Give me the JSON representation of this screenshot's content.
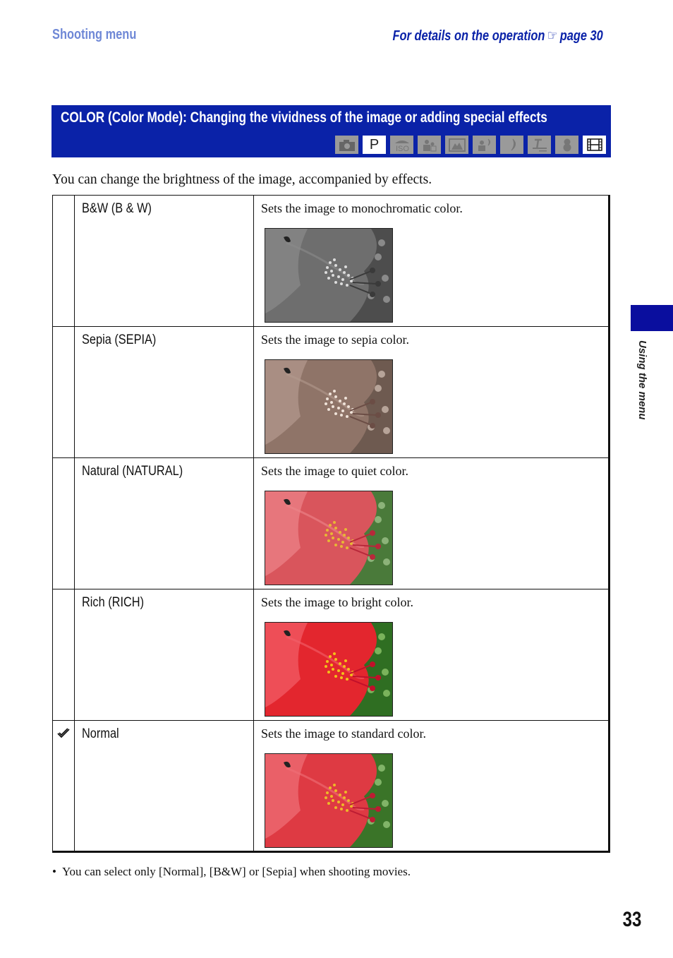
{
  "header": {
    "section": "Shooting menu",
    "details_prefix": "For details on the operation",
    "details_icon": "pointing-hand-icon",
    "details_icon_glyph": "☞",
    "details_page": "page 30"
  },
  "banner": {
    "title": "COLOR (Color Mode): Changing the vividness of the image or adding special effects",
    "modes": [
      {
        "name": "auto-camera-icon",
        "label": "",
        "enabled": false
      },
      {
        "name": "program-icon",
        "label": "P",
        "enabled": true
      },
      {
        "name": "high-sensitivity-iso-icon",
        "label": "",
        "enabled": false
      },
      {
        "name": "soft-snap-portrait-icon",
        "label": "",
        "enabled": false
      },
      {
        "name": "landscape-icon",
        "label": "",
        "enabled": false
      },
      {
        "name": "twilight-portrait-icon",
        "label": "",
        "enabled": false
      },
      {
        "name": "twilight-moon-icon",
        "label": "",
        "enabled": false
      },
      {
        "name": "beach-icon",
        "label": "",
        "enabled": false
      },
      {
        "name": "snow-icon",
        "label": "",
        "enabled": false
      },
      {
        "name": "movie-film-icon",
        "label": "",
        "enabled": true
      }
    ]
  },
  "intro": "You can change the brightness of the image, accompanied by effects.",
  "options": [
    {
      "name": "B&W (B & W)",
      "description": "Sets the image to monochromatic color.",
      "photo": "bw",
      "default": false
    },
    {
      "name": "Sepia (SEPIA)",
      "description": "Sets the image to sepia color.",
      "photo": "sepia",
      "default": false
    },
    {
      "name": "Natural (NATURAL)",
      "description": "Sets the image to quiet color.",
      "photo": "natural",
      "default": false
    },
    {
      "name": "Rich (RICH)",
      "description": "Sets the image to bright color.",
      "photo": "rich",
      "default": false
    },
    {
      "name": "Normal",
      "description": "Sets the image to standard color.",
      "photo": "normal",
      "default": true
    }
  ],
  "note": {
    "bullet": "•",
    "text": "You can select only [Normal], [B&W] or [Sepia] when shooting movies."
  },
  "side_tab": {
    "label": "Using the menu"
  },
  "page_number": "33",
  "colors": {
    "brand_blue": "#0a22a8",
    "header_light_blue": "#6f88d6",
    "disabled_mode_gray": "#9a9a9a"
  }
}
